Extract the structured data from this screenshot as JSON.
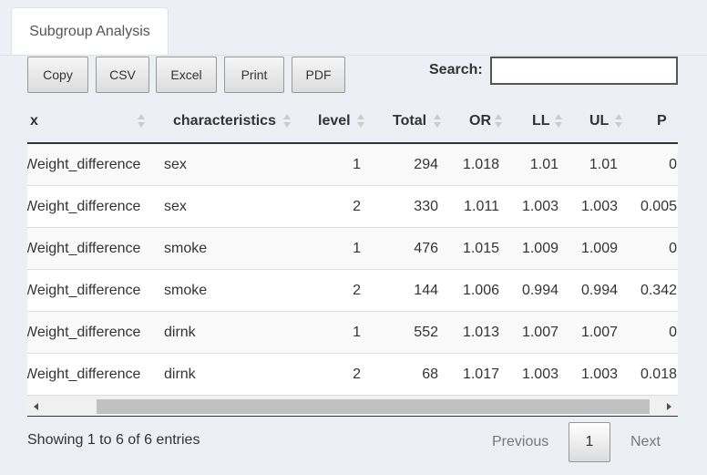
{
  "tab": {
    "label": "Subgroup Analysis"
  },
  "buttons": {
    "copy": "Copy",
    "csv": "CSV",
    "excel": "Excel",
    "print": "Print",
    "pdf": "PDF"
  },
  "search": {
    "label": "Search:",
    "value": ""
  },
  "table": {
    "headers": [
      "x",
      "characteristics",
      "level",
      "Total",
      "OR",
      "LL",
      "UL",
      "P"
    ],
    "rows": [
      [
        "Weight_difference",
        "sex",
        "1",
        "294",
        "1.018",
        "1.01",
        "1.01",
        "0"
      ],
      [
        "Weight_difference",
        "sex",
        "2",
        "330",
        "1.011",
        "1.003",
        "1.003",
        "0.005"
      ],
      [
        "Weight_difference",
        "smoke",
        "1",
        "476",
        "1.015",
        "1.009",
        "1.009",
        "0"
      ],
      [
        "Weight_difference",
        "smoke",
        "2",
        "144",
        "1.006",
        "0.994",
        "0.994",
        "0.342"
      ],
      [
        "Weight_difference",
        "dirnk",
        "1",
        "552",
        "1.013",
        "1.007",
        "1.007",
        "0"
      ],
      [
        "Weight_difference",
        "dirnk",
        "2",
        "68",
        "1.017",
        "1.003",
        "1.003",
        "0.018"
      ]
    ]
  },
  "footer": {
    "info": "Showing 1 to 6 of 6 entries"
  },
  "pagination": {
    "previous": "Previous",
    "page": "1",
    "next": "Next"
  }
}
